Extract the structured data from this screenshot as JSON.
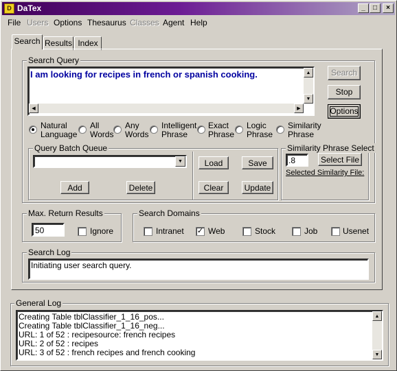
{
  "window": {
    "title": "DaTex",
    "minimize": "_",
    "maximize": "□",
    "close": "×"
  },
  "menu": [
    {
      "label": "File",
      "disabled": false
    },
    {
      "label": "Users",
      "disabled": true
    },
    {
      "label": "Options",
      "disabled": false
    },
    {
      "label": "Thesaurus",
      "disabled": false
    },
    {
      "label": "Classes",
      "disabled": true
    },
    {
      "label": "Agent",
      "disabled": false
    },
    {
      "label": "Help",
      "disabled": false
    }
  ],
  "tabs": {
    "search": "Search",
    "results": "Results",
    "index": "Index"
  },
  "search_query": {
    "label": "Search Query",
    "text": "I am looking for recipes in french or spanish cooking.",
    "text_color": "#0000a0"
  },
  "buttons": {
    "search": "Search",
    "stop": "Stop",
    "options": "Options"
  },
  "query_types": [
    {
      "line1": "Natural",
      "line2": "Language",
      "selected": true
    },
    {
      "line1": "All",
      "line2": "Words",
      "selected": false
    },
    {
      "line1": "Any",
      "line2": "Words",
      "selected": false
    },
    {
      "line1": "Intelligent",
      "line2": "Phrase",
      "selected": false
    },
    {
      "line1": "Exact",
      "line2": "Phrase",
      "selected": false
    },
    {
      "line1": "Logic",
      "line2": "Phrase",
      "selected": false
    },
    {
      "line1": "Similarity",
      "line2": "Phrase",
      "selected": false
    }
  ],
  "batch_queue": {
    "label": "Query Batch Queue",
    "value": "",
    "load": "Load",
    "save": "Save",
    "add": "Add",
    "delete": "Delete",
    "clear": "Clear",
    "update": "Update"
  },
  "similarity": {
    "label": "Similarity Phrase Select",
    "value": ".8",
    "select_file": "Select File",
    "selected_file_label": "Selected Similarity File:"
  },
  "max_results": {
    "label": "Max. Return Results",
    "value": "50",
    "ignore_label": "Ignore",
    "ignore_checked": false
  },
  "domains": {
    "label": "Search Domains",
    "items": [
      {
        "label": "Intranet",
        "checked": false
      },
      {
        "label": "Web",
        "checked": true
      },
      {
        "label": "Stock",
        "checked": false
      },
      {
        "label": "Job",
        "checked": false
      },
      {
        "label": "Usenet",
        "checked": false
      }
    ]
  },
  "search_log": {
    "label": "Search Log",
    "lines": [
      "Initiating user search query."
    ]
  },
  "general_log": {
    "label": "General Log",
    "lines": [
      "Creating Table tblClassifier_1_16_pos...",
      "Creating Table tblClassifier_1_16_neg...",
      "URL: 1 of 52 : recipesource: french recipes",
      "URL: 2 of 52 : recipes",
      "URL: 3 of 52 : french recipes and french cooking"
    ]
  },
  "colors": {
    "title_start": "#400058",
    "title_end": "#b0a8c4",
    "face": "#d4d0c8"
  }
}
